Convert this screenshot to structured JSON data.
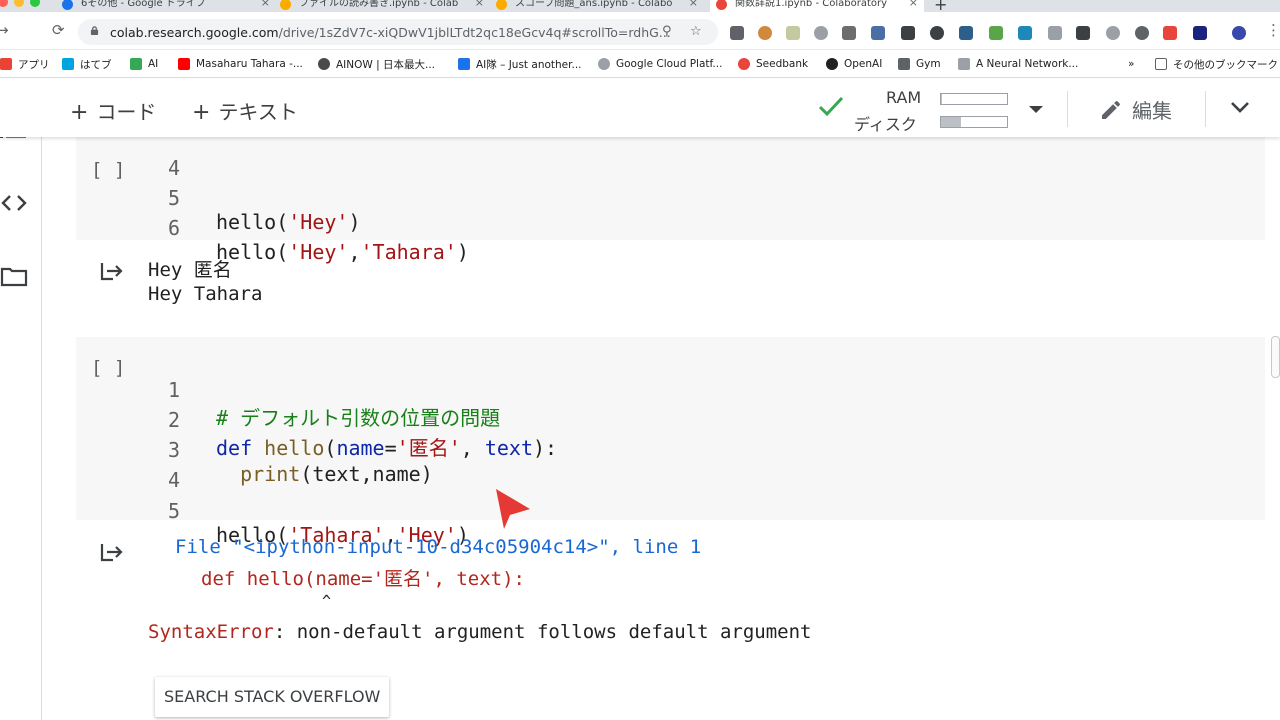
{
  "browser": {
    "tabs": [
      {
        "title": "6その他 - Google ドライブ",
        "favicon_color": "#1a73e8"
      },
      {
        "title": "ファイルの読み書き.ipynb - Colab",
        "favicon_color": "#f9ab00"
      },
      {
        "title": "スコープ問題_ans.ipynb - Colabo",
        "favicon_color": "#f9ab00"
      },
      {
        "title": "関数詳説1.ipynb - Colaboratory",
        "favicon_color": "#e8453c"
      }
    ],
    "new_tab": "+",
    "close_glyph": "×",
    "url_host": "colab.research.google.com",
    "url_path": "/drive/1sZdV7c-xiQDwV1jblLTdt2qc18eGcv4q#scrollTo=rdhG...",
    "bookmarks": [
      {
        "label": "アプリ",
        "color": "#ea4335"
      },
      {
        "label": "はてブ",
        "color": "#00a4de"
      },
      {
        "label": "AI",
        "color": "#34a853"
      },
      {
        "label": "Masaharu Tahara -...",
        "color": "#ff0000"
      },
      {
        "label": "AINOW | 日本最大...",
        "color": "#4a4a4a"
      },
      {
        "label": "AI隊 – Just another...",
        "color": "#1a73e8"
      },
      {
        "label": "Google Cloud Platf...",
        "color": "#9aa0a6"
      },
      {
        "label": "Seedbank",
        "color": "#e8453c"
      },
      {
        "label": "OpenAI",
        "color": "#202124"
      },
      {
        "label": "Gym",
        "color": "#5f6368"
      },
      {
        "label": "A Neural Network...",
        "color": "#9aa0a6"
      }
    ],
    "bookmarks_more": "»",
    "other_bookmarks": "その他のブックマーク"
  },
  "toolbar": {
    "add_code": "コード",
    "add_text": "テキスト",
    "plus": "+",
    "ram_label": "RAM",
    "disk_label": "ディスク",
    "ram_fraction": 0.02,
    "disk_fraction": 0.3,
    "edit_label": "編集"
  },
  "cells": {
    "cell1": {
      "run_slot": "[ ]",
      "lines": [
        {
          "n": "4",
          "code": ""
        },
        {
          "n": "5",
          "code": "hello('Hey')"
        },
        {
          "n": "6",
          "code": "hello('Hey','Tahara')"
        }
      ],
      "output": [
        "Hey 匿名",
        "Hey Tahara"
      ]
    },
    "cell2": {
      "run_slot": "[ ]",
      "lines": [
        {
          "n": "1",
          "code": "# デフォルト引数の位置の問題"
        },
        {
          "n": "2",
          "code": "def hello(name='匿名', text):"
        },
        {
          "n": "3",
          "code": "  print(text,name)"
        },
        {
          "n": "4",
          "code": ""
        },
        {
          "n": "5",
          "code": "hello('Tahara','Hey')"
        }
      ],
      "output": {
        "file_line": "File \"<ipython-input-10-d34c05904c14>\", line 1",
        "code_line": "def hello(name='匿名', text):",
        "caret": "^",
        "error_type": "SyntaxError",
        "error_msg": ": non-default argument follows default argument"
      },
      "search_button": "SEARCH STACK OVERFLOW"
    }
  }
}
